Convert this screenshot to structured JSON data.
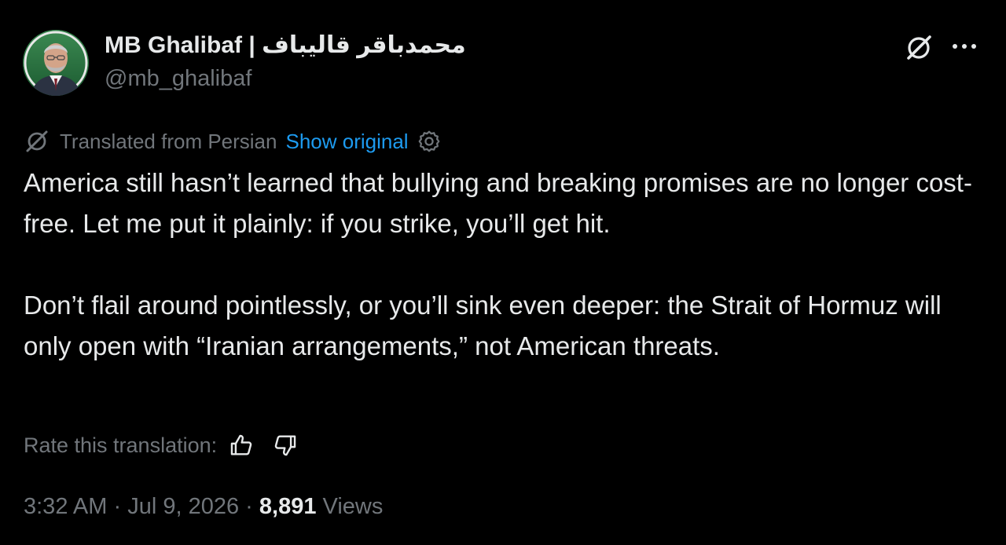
{
  "author": {
    "display_name": "محمدباقر قالیباف | MB Ghalibaf",
    "handle": "@mb_ghalibaf",
    "avatar_icon": "profile-photo"
  },
  "header_actions": {
    "grok_icon": "grok-slash-circle-icon",
    "more_icon": "more-horizontal-icon"
  },
  "translation": {
    "icon": "translate-slash-icon",
    "label": "Translated from Persian",
    "show_original": "Show original",
    "settings_icon": "gear-icon"
  },
  "tweet": {
    "paragraphs": [
      "America still hasn’t learned that bullying and breaking promises are no longer cost-free. Let me put it plainly: if you strike, you’ll get hit.",
      "Don’t flail around pointlessly, or you’ll sink even deeper: the Strait of Hormuz will only open with “Iranian arrangements,” not American threats."
    ]
  },
  "rating": {
    "label": "Rate this translation:",
    "thumbs_up_icon": "thumbs-up-icon",
    "thumbs_down_icon": "thumbs-down-icon"
  },
  "meta": {
    "time": "3:32 AM",
    "date": "Jul 9, 2026",
    "separator": "·",
    "views_count": "8,891",
    "views_label": "Views"
  },
  "colors": {
    "background": "#000000",
    "text_primary": "#e7e9ea",
    "text_secondary": "#71767b",
    "link": "#1d9bf0"
  }
}
